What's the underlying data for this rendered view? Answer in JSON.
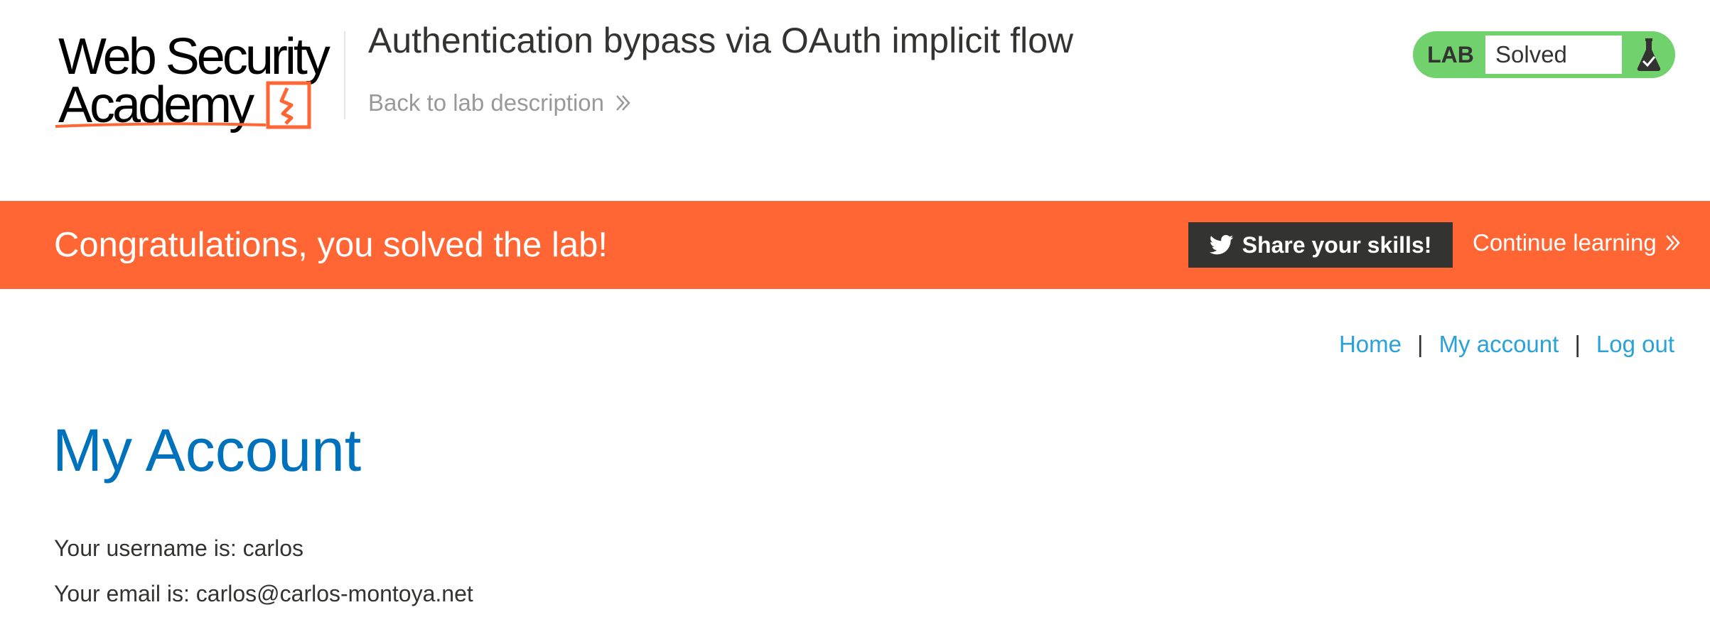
{
  "header": {
    "logo_line1": "Web Security",
    "logo_line2": "Academy",
    "lab_title": "Authentication bypass via OAuth implicit flow",
    "back_link": "Back to lab description",
    "status": {
      "label": "LAB",
      "value": "Solved",
      "icon": "flask-check-icon",
      "color": "#70d16d"
    }
  },
  "banner": {
    "message": "Congratulations, you solved the lab!",
    "share_button": "Share your skills!",
    "share_icon": "twitter-icon",
    "continue_link": "Continue learning",
    "color": "#ff6633"
  },
  "nav": {
    "items": [
      {
        "label": "Home"
      },
      {
        "label": "My account"
      },
      {
        "label": "Log out"
      }
    ],
    "separator": "|"
  },
  "main": {
    "title": "My Account",
    "username_line": "Your username is: carlos",
    "email_line": "Your email is: carlos@carlos-montoya.net"
  }
}
